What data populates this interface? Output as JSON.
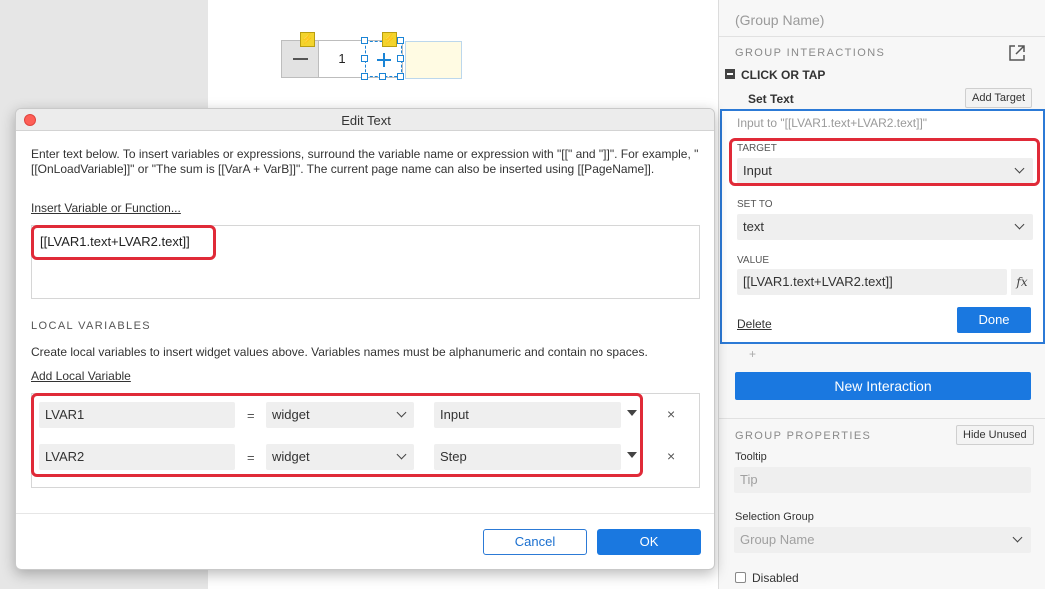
{
  "canvas": {
    "stepper_value": "1",
    "bolt_icon": "⚡"
  },
  "right_panel": {
    "group_name": "(Group Name)",
    "group_interactions_title": "GROUP INTERACTIONS",
    "event_label": "CLICK OR TAP",
    "action_label": "Set Text",
    "add_target_label": "Add Target",
    "action_summary": "Input to \"[[LVAR1.text+LVAR2.text]]\"",
    "target_label": "TARGET",
    "target_value": "Input",
    "set_to_label": "SET TO",
    "set_to_value": "text",
    "value_label": "VALUE",
    "value_text": "[[LVAR1.text+LVAR2.text]]",
    "fx_label": "fx",
    "delete_label": "Delete",
    "done_label": "Done",
    "add_action_glyph": "+",
    "new_interaction_label": "New Interaction",
    "group_properties_title": "GROUP PROPERTIES",
    "hide_unused_label": "Hide Unused",
    "tooltip_label": "Tooltip",
    "tooltip_placeholder": "Tip",
    "selection_group_label": "Selection Group",
    "selection_group_placeholder": "Group Name",
    "disabled_label": "Disabled"
  },
  "dialog": {
    "title": "Edit Text",
    "instructions": "Enter text below. To insert variables or expressions, surround the variable name or expression with \"[[\" and \"]]\". For example, \"[[OnLoadVariable]]\" or \"The sum is [[VarA + VarB]]\". The current page name can also be inserted using [[PageName]].",
    "insert_link": "Insert Variable or Function...",
    "text_value": "[[LVAR1.text+LVAR2.text]]",
    "local_vars_title": "LOCAL VARIABLES",
    "local_vars_desc": "Create local variables to insert widget values above. Variables names must be alphanumeric and contain no spaces.",
    "add_local_link": "Add Local Variable",
    "variables": [
      {
        "name": "LVAR1",
        "eq": "=",
        "type": "widget",
        "widget": "Input",
        "remove": "×"
      },
      {
        "name": "LVAR2",
        "eq": "=",
        "type": "widget",
        "widget": "Step",
        "remove": "×"
      }
    ],
    "cancel_label": "Cancel",
    "ok_label": "OK"
  },
  "colors": {
    "accent": "#1a78e0",
    "highlight": "#e02a38",
    "selection": "#2c7ad6"
  }
}
